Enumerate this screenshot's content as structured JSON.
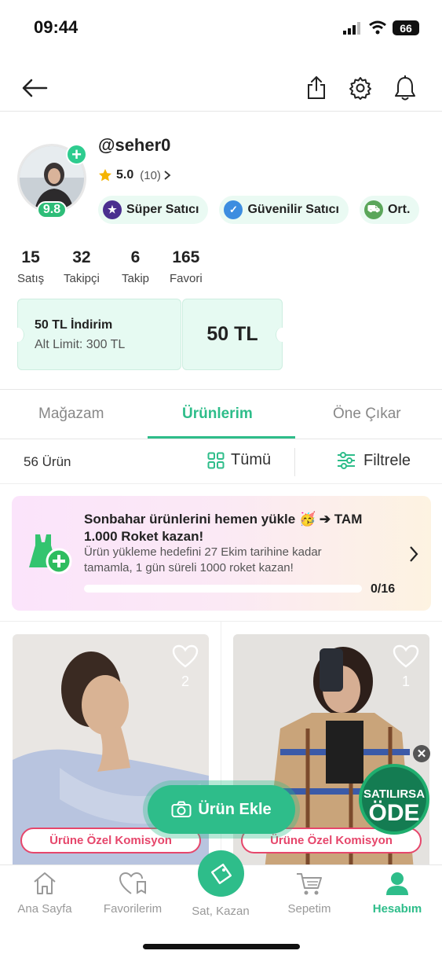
{
  "status_bar": {
    "time": "09:44",
    "battery": "66"
  },
  "profile": {
    "username": "@seher0",
    "rating": "5.0",
    "review_count": "(10)",
    "seller_score": "9.8",
    "badges": [
      {
        "label": "Süper Satıcı",
        "icon": "star-badge-icon",
        "color": "#4a2f8f"
      },
      {
        "label": "Güvenilir Satıcı",
        "icon": "check-badge-icon",
        "color": "#3d8de0"
      },
      {
        "label": "Ort.",
        "icon": "truck-badge-icon",
        "color": "#5aa65a"
      }
    ],
    "stats": [
      {
        "value": "15",
        "label": "Satış"
      },
      {
        "value": "32",
        "label": "Takipçi"
      },
      {
        "value": "6",
        "label": "Takip"
      },
      {
        "value": "165",
        "label": "Favori"
      }
    ]
  },
  "coupon": {
    "title": "50 TL İndirim",
    "limit": "Alt Limit: 300 TL",
    "amount": "50 TL"
  },
  "tabs": [
    {
      "label": "Mağazam",
      "active": false
    },
    {
      "label": "Ürünlerim",
      "active": true
    },
    {
      "label": "Öne Çıkar",
      "active": false
    }
  ],
  "filter_row": {
    "count": "56 Ürün",
    "all_label": "Tümü",
    "filter_label": "Filtrele"
  },
  "promo": {
    "title": "Sonbahar ürünlerini hemen yükle 🥳 ➔ TAM 1.000 Roket kazan!",
    "description": "Ürün yükleme hedefini 27 Ekim tarihine kadar tamamla, 1 gün süreli 1000 roket kazan!",
    "progress_text": "0/16",
    "progress_fraction": 0
  },
  "products": [
    {
      "likes": "2",
      "commission_label": "Ürüne Özel Komisyon"
    },
    {
      "likes": "1",
      "commission_label": "Ürüne Özel Komisyon"
    }
  ],
  "add_product_label": "Ürün Ekle",
  "promo_badge": {
    "line1": "SATILIRSA",
    "line2": "ÖDE"
  },
  "bottom_nav": [
    {
      "label": "Ana Sayfa",
      "icon": "home-icon",
      "active": false
    },
    {
      "label": "Favorilerim",
      "icon": "heart-list-icon",
      "active": false
    },
    {
      "label": "Sat, Kazan",
      "icon": "tag-icon",
      "active": false
    },
    {
      "label": "Sepetim",
      "icon": "cart-icon",
      "active": false
    },
    {
      "label": "Hesabım",
      "icon": "person-icon",
      "active": true
    }
  ],
  "colors": {
    "accent": "#2ebd8a",
    "commission": "#e6466b",
    "coupon_bg": "#e6faf2"
  }
}
